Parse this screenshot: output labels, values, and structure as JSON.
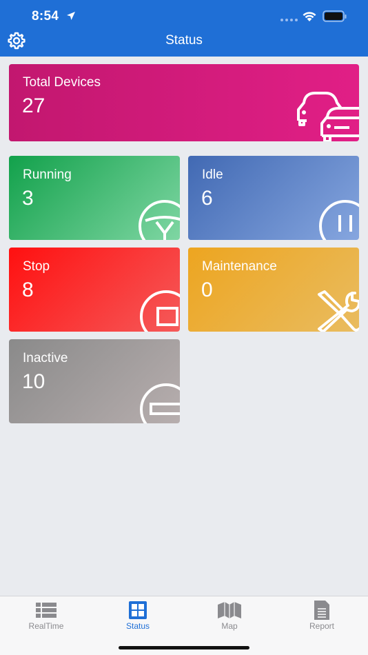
{
  "status_bar": {
    "time": "8:54"
  },
  "header": {
    "title": "Status",
    "settings_icon": "gear-icon"
  },
  "cards": {
    "total": {
      "label": "Total Devices",
      "value": "27",
      "icon": "cars-icon",
      "color": "#c2176f"
    },
    "running": {
      "label": "Running",
      "value": "3",
      "icon": "steering-wheel-icon",
      "color": "#12a14b"
    },
    "idle": {
      "label": "Idle",
      "value": "6",
      "icon": "pause-icon",
      "color": "#4169b3"
    },
    "stop": {
      "label": "Stop",
      "value": "8",
      "icon": "stop-icon",
      "color": "#ff1010"
    },
    "maintenance": {
      "label": "Maintenance",
      "value": "0",
      "icon": "tools-icon",
      "color": "#eda520"
    },
    "inactive": {
      "label": "Inactive",
      "value": "10",
      "icon": "minus-circle-icon",
      "color": "#8a8a8a"
    }
  },
  "tabs": [
    {
      "label": "RealTime",
      "icon": "list-icon",
      "active": false
    },
    {
      "label": "Status",
      "icon": "grid-icon",
      "active": true
    },
    {
      "label": "Map",
      "icon": "map-icon",
      "active": false
    },
    {
      "label": "Report",
      "icon": "document-icon",
      "active": false
    }
  ],
  "colors": {
    "accent": "#1f6fd6",
    "background": "#e9ebef"
  }
}
